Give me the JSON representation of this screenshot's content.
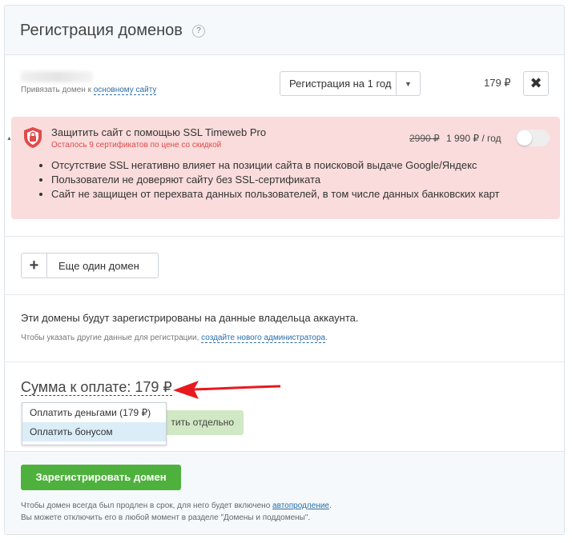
{
  "header": {
    "title": "Регистрация доменов",
    "help_icon": "?"
  },
  "domain": {
    "bind_prefix": "Привязать домен к ",
    "bind_link": "основному сайту",
    "period": "Регистрация на 1 год",
    "price": "179 ₽",
    "remove_icon": "✖"
  },
  "ssl": {
    "title": "Защитить сайт с помощью SSL Timeweb Pro",
    "subtitle": "Осталось 9 сертификатов по цене со скидкой",
    "old_price": "2990 ₽",
    "new_price": "1 990 ₽ / год",
    "enabled": false,
    "bullets": [
      "Отсутствие SSL негативно влияет на позиции сайта в поисковой выдаче Google/Яндекс",
      "Пользователи не доверяют сайту без SSL-сертификата",
      "Сайт не защищен от перехвата данных пользователей, в том числе данных банковских карт"
    ],
    "accent_color": "#e24a4a",
    "background_color": "#fadcdc"
  },
  "add_domain": {
    "label": "Еще один домен"
  },
  "owner": {
    "text": "Эти домены будут зарегистрированы на данные владельца аккаунта.",
    "note_prefix": "Чтобы указать другие данные для регистрации, ",
    "note_link": "создайте нового администратора",
    "note_suffix": "."
  },
  "payment": {
    "sum_label": "Сумма к оплате: 179 ₽",
    "pay_separately": "тить отдельно",
    "options": [
      "Оплатить деньгами (179 ₽)",
      "Оплатить бонусом"
    ],
    "highlighted_option": "Оплатить бонусом"
  },
  "footer": {
    "register_button": "Зарегистрировать домен",
    "note_line1_prefix": "Чтобы домен всегда был продлен в срок, для него будет включено ",
    "note_line1_link": "автопродление",
    "note_line1_suffix": ".",
    "note_line2": "Вы можете отключить его в любой момент в разделе \"Домены и поддомены\".",
    "button_color": "#4fb13d"
  }
}
